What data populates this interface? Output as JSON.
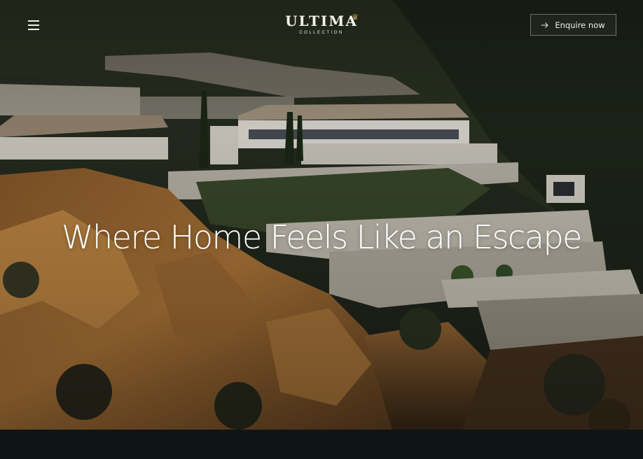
{
  "header": {
    "logo_text": "ULTIMA",
    "logo_subtext": "COLLECTION",
    "enquire_label": "Enquire now"
  },
  "hero": {
    "headline": "Where Home Feels Like an Escape"
  },
  "colors": {
    "accent_gold": "#c9a45a",
    "bottom_band": "#0f1416",
    "text_light": "#f2efe8"
  },
  "icons": {
    "menu": "hamburger-icon",
    "enquire": "arrow-right-icon",
    "logo_mark": "crown-icon"
  }
}
